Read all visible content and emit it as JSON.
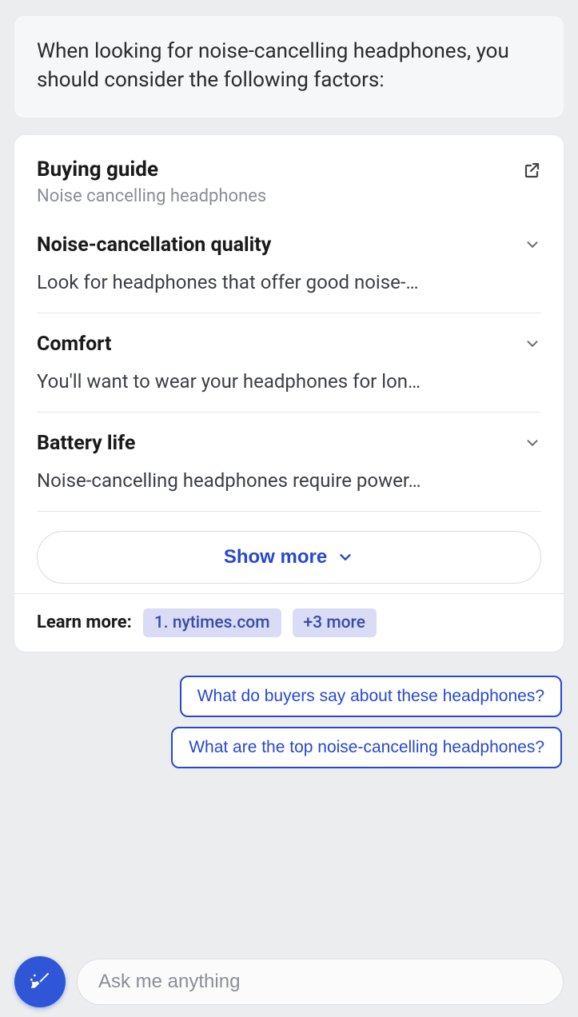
{
  "intro": "When looking for noise-cancelling headphones, you should consider the following factors:",
  "guide": {
    "title": "Buying guide",
    "subtitle": "Noise cancelling headphones",
    "sections": [
      {
        "title": "Noise-cancellation quality",
        "body": "Look for headphones that offer good noise-…"
      },
      {
        "title": "Comfort",
        "body": "You'll want to wear your headphones for lon…"
      },
      {
        "title": "Battery life",
        "body": "Noise-cancelling headphones require power…"
      }
    ],
    "show_more": "Show more",
    "learn_more_label": "Learn more:",
    "sources": [
      "1. nytimes.com",
      "+3 more"
    ]
  },
  "suggestions": [
    "What do buyers say about these headphones?",
    "What are the top noise-cancelling headphones?"
  ],
  "input": {
    "placeholder": "Ask me anything"
  }
}
